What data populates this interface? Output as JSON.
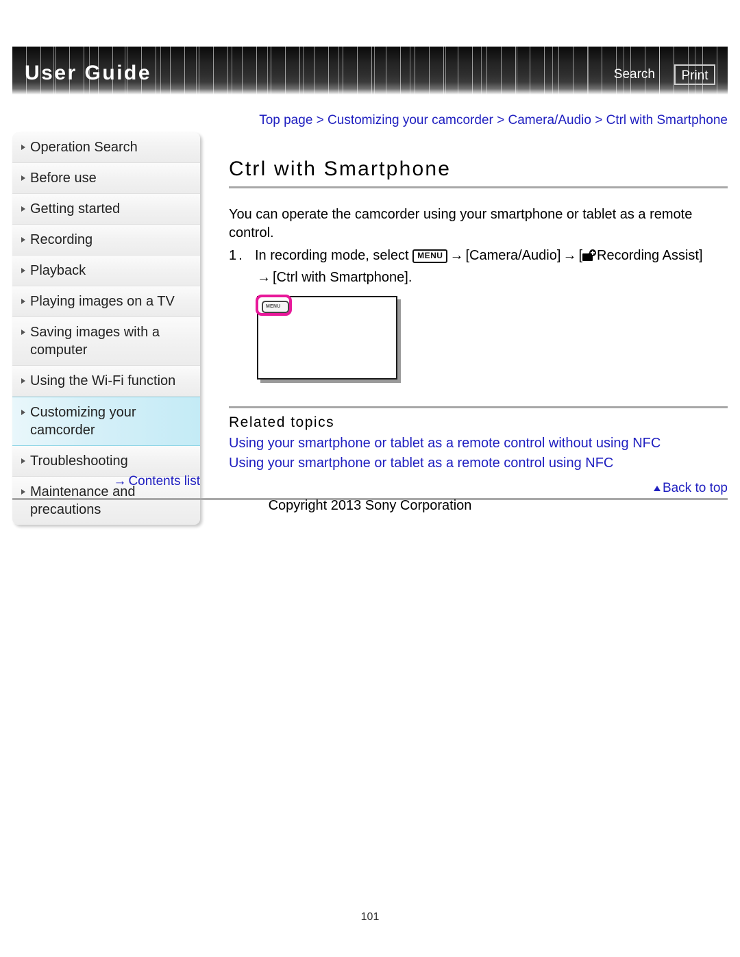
{
  "header": {
    "title": "User Guide",
    "search_label": "Search",
    "print_label": "Print"
  },
  "sidebar": {
    "items": [
      {
        "label": "Operation Search",
        "active": false
      },
      {
        "label": "Before use",
        "active": false
      },
      {
        "label": "Getting started",
        "active": false
      },
      {
        "label": "Recording",
        "active": false
      },
      {
        "label": "Playback",
        "active": false
      },
      {
        "label": "Playing images on a TV",
        "active": false
      },
      {
        "label": "Saving images with a computer",
        "active": false
      },
      {
        "label": "Using the Wi-Fi function",
        "active": false
      },
      {
        "label": "Customizing your camcorder",
        "active": true
      },
      {
        "label": "Troubleshooting",
        "active": false
      },
      {
        "label": "Maintenance and precautions",
        "active": false
      }
    ],
    "contents_list_label": "Contents list",
    "contents_list_arrow": "→"
  },
  "main": {
    "breadcrumb": "Top page > Customizing your camcorder > Camera/Audio > Ctrl with Smartphone",
    "title": "Ctrl with Smartphone",
    "intro": "You can operate the camcorder using your smartphone or tablet as a remote control.",
    "step": {
      "number": "1.",
      "text_before_menu": "In recording mode, select",
      "menu_icon_label": "MENU",
      "arrow": "→",
      "camera_audio": "[Camera/Audio]",
      "bracket_open": "[",
      "recording_assist": "Recording Assist]",
      "line2": "[Ctrl with Smartphone]."
    },
    "figure": {
      "menu_button_label": "MENU",
      "highlight_color": "#e8189a"
    },
    "related": {
      "heading": "Related topics",
      "links": [
        "Using your smartphone or tablet as a remote control without using NFC",
        "Using your smartphone or tablet as a remote control using NFC"
      ]
    },
    "back_to_top_label": "Back to top"
  },
  "footer": {
    "copyright": "Copyright 2013 Sony Corporation",
    "page_number": "101"
  },
  "colors": {
    "link_blue": "#2020c0",
    "banner_black": "#141414",
    "active_nav_cyan": "#c4ebf6",
    "rule_gray": "#a8a8a8"
  }
}
